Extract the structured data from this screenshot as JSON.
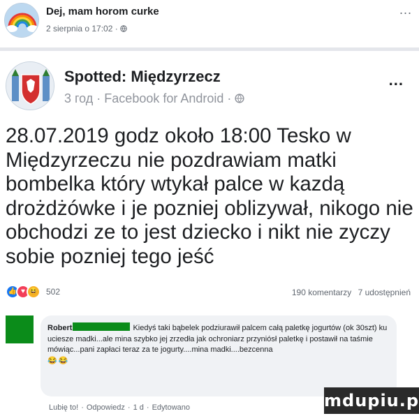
{
  "outer_post": {
    "author": "Dej, mam horom curke",
    "meta": "2 sierpnia o 17:02 · ",
    "audience_icon": "globe-icon",
    "more": "..."
  },
  "post": {
    "page_name": "Spotted: Międzyrzecz",
    "meta": "3 год · Facebook for Android · ",
    "audience_icon": "globe-icon",
    "more": "...",
    "text": "28.07.2019 godz około 18:00 Tesko w Międzyrzeczu nie pozdrawiam matki bombelka który wtykał palce w kazdą drożdżówke i je pozniej oblizywał, nikogo nie obchodzi ze to jest dziecko i nikt nie zyczy sobie pozniej tego jeść"
  },
  "reactions": {
    "icons": [
      "like-icon",
      "love-icon",
      "haha-icon"
    ],
    "count": "502",
    "comments": "190 komentarzy",
    "shares": "7 udostępnień"
  },
  "comment": {
    "author": "Robert",
    "text": "Kiedyś taki bąbelek podziurawił palcem całą paletkę jogurtów (ok 30szt) ku uciesze madki...ale mina szybko jej zrzedła jak ochroniarz przyniósł paletkę i postawił na taśmie mówiąc...pani zapłaci teraz za te jogurty....mina madki....bezcenna",
    "emojis": "😂😂",
    "like": "Lubię to!",
    "reply": "Odpowiedz",
    "time": "1 d",
    "edited": "Edytowano"
  },
  "watermark": "mdupiu.pl",
  "colors": {
    "accent": "#1877f2",
    "redaction": "#0b8c1a",
    "muted": "#606770"
  }
}
